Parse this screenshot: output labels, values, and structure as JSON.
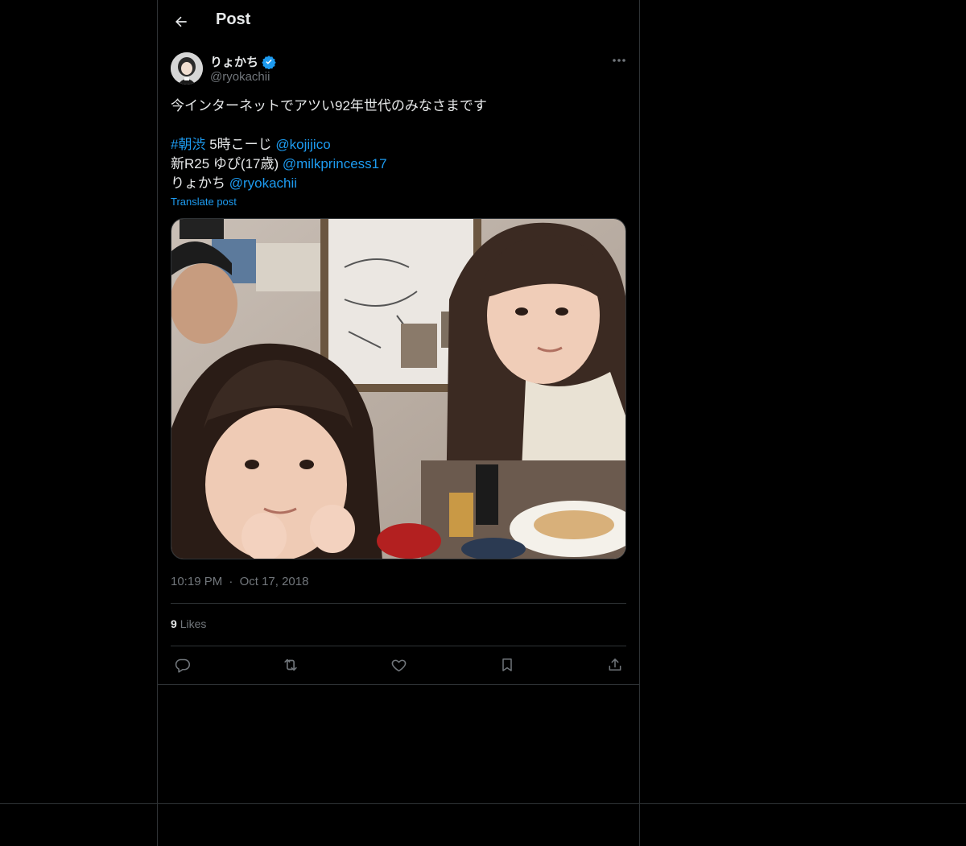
{
  "header": {
    "title": "Post"
  },
  "author": {
    "display_name": "りょかち",
    "handle": "@ryokachii",
    "verified": true
  },
  "post": {
    "line1": "今インターネットでアツい92年世代のみなさまです",
    "line2": {
      "hashtag": "#朝渋",
      "text": " 5時こーじ ",
      "mention": "@kojijico"
    },
    "line3": {
      "text": "新R25 ゆぴ(17歳) ",
      "mention": "@milkprincess17"
    },
    "line4": {
      "text": "りょかち ",
      "mention": "@ryokachii"
    },
    "translate": "Translate post"
  },
  "meta": {
    "time": "10:19 PM",
    "sep": "·",
    "date": "Oct 17, 2018"
  },
  "stats": {
    "likes_count": "9",
    "likes_label": "Likes"
  },
  "colors": {
    "accent": "#1d9bf0",
    "text": "#e7e9ea",
    "muted": "#71767b",
    "border": "#2f3336",
    "bg": "#000000"
  },
  "icons": {
    "back": "arrow-left-icon",
    "more": "more-dots-icon",
    "verified": "verified-badge-icon",
    "reply": "reply-icon",
    "repost": "repost-icon",
    "like": "heart-icon",
    "bookmark": "bookmark-icon",
    "share": "share-icon"
  }
}
